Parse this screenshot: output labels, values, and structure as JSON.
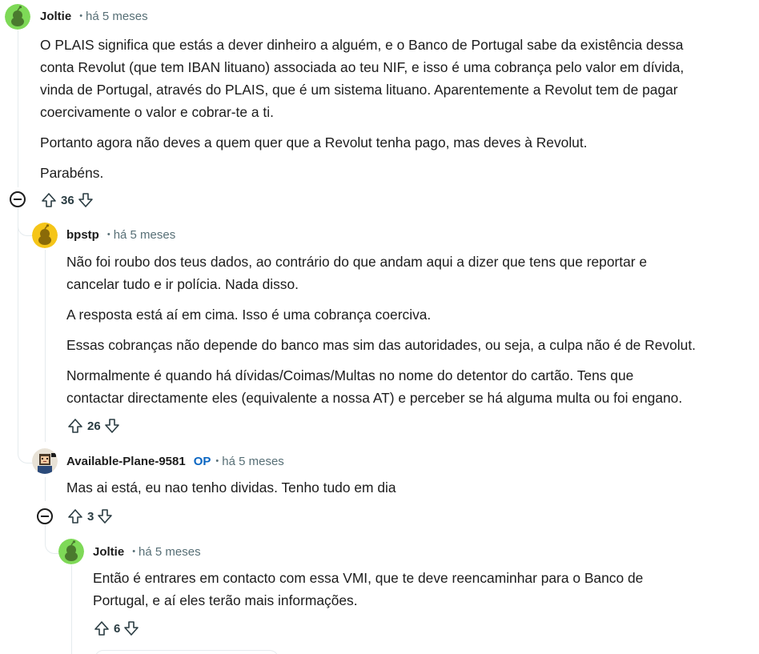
{
  "comments": [
    {
      "author": "Joltie",
      "time": "há 5 meses",
      "paragraphs": [
        "O PLAIS significa que estás a dever dinheiro a alguém, e o Banco de Portugal sabe da existência dessa",
        "conta Revolut (que tem IBAN lituano) associada ao teu NIF, e isso é uma cobrança pelo valor em dívida,",
        "vinda de Portugal, através do PLAIS, que é um sistema lituano. Aparentemente a Revolut tem de pagar",
        "coercivamente o valor e cobrar-te a ti.",
        "Portanto agora não deves a quem quer que a Revolut tenha pago, mas deves à Revolut.",
        "Parabéns."
      ],
      "score": "36",
      "avatar": "reddit-snoo-green-avatar"
    },
    {
      "author": "bpstp",
      "time": "há 5 meses",
      "paragraphs": [
        "Não foi roubo dos teus dados, ao contrário do que andam aqui a dizer que tens que reportar e",
        "cancelar tudo e ir polícia. Nada disso.",
        "A resposta está aí em cima. Isso é uma cobrança coerciva.",
        "Essas cobranças não depende do banco mas sim das autoridades, ou seja, a culpa não é de Revolut.",
        "Normalmente é quando há dívidas/Coimas/Multas no nome do detentor do cartão. Tens que",
        "contactar directamente eles (equivalente a nossa AT) e perceber se há alguma multa ou foi engano."
      ],
      "score": "26",
      "avatar": "reddit-snoo-yellow-avatar"
    },
    {
      "author": "Available-Plane-9581",
      "op_label": "OP",
      "time": "há 5 meses",
      "paragraphs": [
        "Mas ai está, eu nao tenho dividas. Tenho tudo em dia"
      ],
      "score": "3",
      "avatar": "pixel-character-avatar"
    },
    {
      "author": "Joltie",
      "time": "há 5 meses",
      "paragraphs": [
        "Então é entrares em contacto com essa VMI, que te deve reencaminhar para o Banco de",
        "Portugal, e aí eles terão mais informações."
      ],
      "score": "6",
      "avatar": "reddit-snoo-green-avatar"
    }
  ],
  "meta_separator": "•",
  "icons": {
    "upvote": "upvote-arrow-icon",
    "downvote": "downvote-arrow-icon",
    "collapse": "collapse-minus-icon"
  },
  "colors": {
    "op_badge": "#0a66c2",
    "muted_text": "#576f76",
    "thread_line": "#e5ebee",
    "snoo_green": "#7ed957",
    "snoo_yellow": "#f5c518"
  }
}
